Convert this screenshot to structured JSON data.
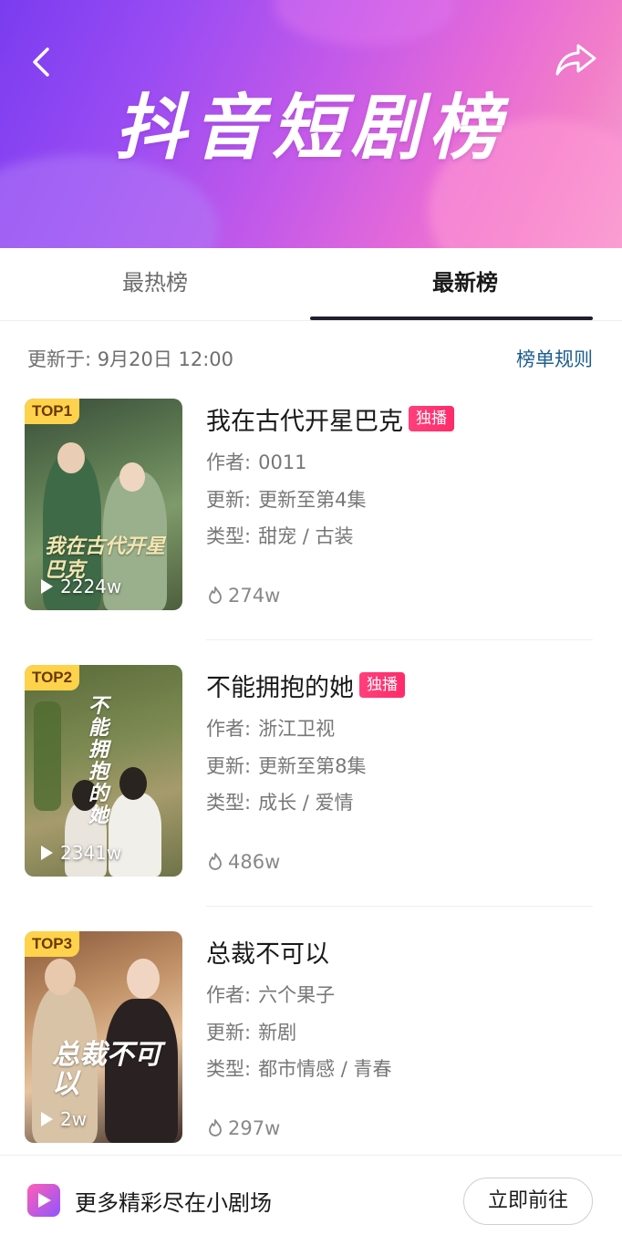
{
  "header": {
    "title": "抖音短剧榜",
    "back_icon": "chevron-left-icon",
    "share_icon": "share-icon"
  },
  "tabs": [
    {
      "label": "最热榜",
      "active": false
    },
    {
      "label": "最新榜",
      "active": true
    }
  ],
  "update": {
    "text": "更新于: 9月20日 12:00",
    "rules_label": "榜单规则"
  },
  "items": [
    {
      "rank": "TOP1",
      "title": "我在古代开星巴克",
      "badge": "独播",
      "author_key": "作者:",
      "author": "0011",
      "update_key": "更新:",
      "update": "更新至第4集",
      "genre_key": "类型:",
      "genre": "甜宠 / 古装",
      "plays": "2224w",
      "heat": "274w",
      "poster_text": "我在古代开星巴克"
    },
    {
      "rank": "TOP2",
      "title": "不能拥抱的她",
      "badge": "独播",
      "author_key": "作者:",
      "author": "浙江卫视",
      "update_key": "更新:",
      "update": "更新至第8集",
      "genre_key": "类型:",
      "genre": "成长 / 爱情",
      "plays": "2341w",
      "heat": "486w",
      "poster_text": "不能拥抱的她"
    },
    {
      "rank": "TOP3",
      "title": "总裁不可以",
      "badge": "",
      "author_key": "作者:",
      "author": "六个果子",
      "update_key": "更新:",
      "update": "新剧",
      "genre_key": "类型:",
      "genre": "都市情感 / 青春",
      "plays": "2w",
      "heat": "297w",
      "poster_text": "总裁不可以"
    }
  ],
  "bottom": {
    "text": "更多精彩尽在小剧场",
    "button_label": "立即前往"
  },
  "colors": {
    "accent_pink": "#ff2b6a",
    "rank_gold": "#ffd24c",
    "link_blue": "#1d5e8f"
  }
}
